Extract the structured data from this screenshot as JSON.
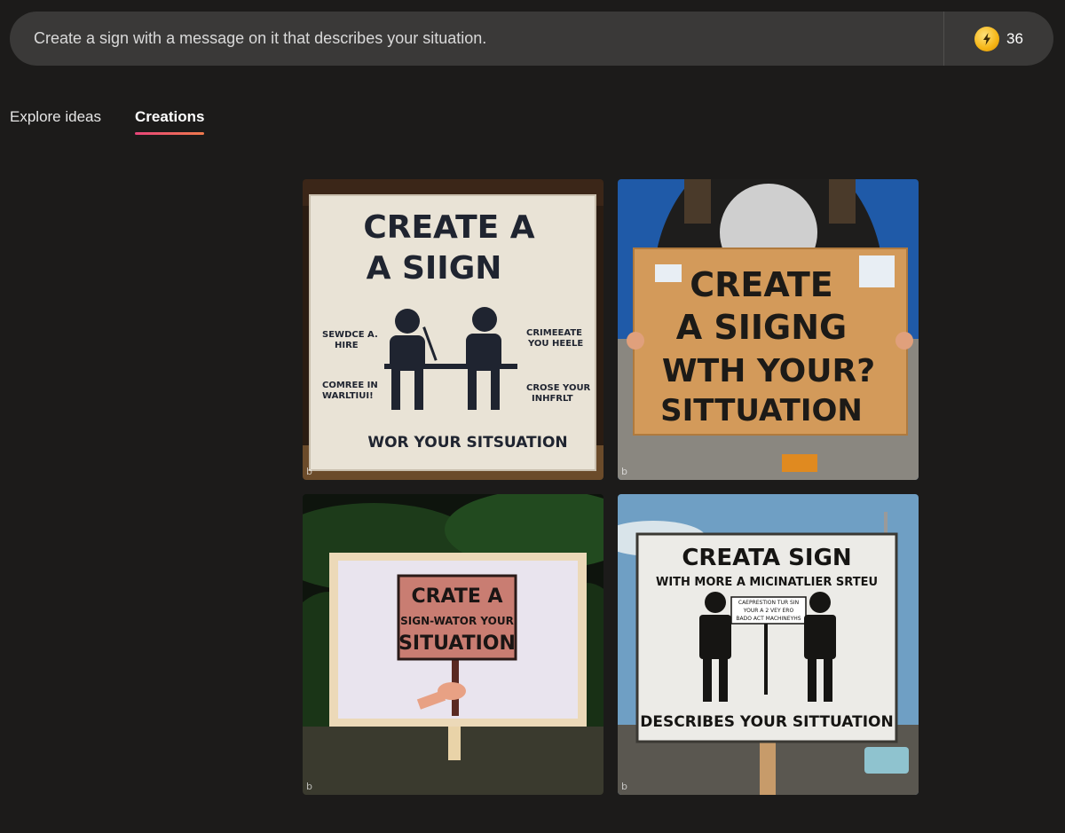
{
  "prompt": {
    "text": "Create a sign with a message on it that describes your situation."
  },
  "boosts": {
    "icon": "lightning-coin-icon",
    "count": "36"
  },
  "tabs": [
    {
      "label": "Explore ideas",
      "active": false
    },
    {
      "label": "Creations",
      "active": true
    }
  ],
  "colors": {
    "accent_start": "#e8457a",
    "accent_end": "#f07a4c"
  },
  "images": [
    {
      "sign_line1": "CREATE A",
      "sign_line2": "A SIIGN",
      "left_note1_a": "SEWDCE A.",
      "left_note1_b": "HIRE",
      "right_note1_a": "CRIMEEATE",
      "right_note1_b": "YOU HEELE",
      "left_note2_a": "COMREE IN",
      "left_note2_b": "WARLTIUI!",
      "right_note2_a": "CROSE YOUR",
      "right_note2_b": "INHFRLT",
      "footer": "WOR YOUR SITSUATION",
      "watermark": "b"
    },
    {
      "line1": "CREATE",
      "line2": "A SIIGNG",
      "line3": "WTH YOUR?",
      "line4": "SITTUATION",
      "watermark": "b"
    },
    {
      "line1": "CRATE A",
      "line2": "SIGN-WATOR YOUR",
      "line3": "SITUATION",
      "watermark": "b"
    },
    {
      "line1": "CREATA SIGN",
      "line2": "WITH MORE A MICINATLIER SRTEU",
      "bubble1": "CAEPRESTION TUR SIN",
      "bubble2": "YOUR A 2 VEY ERO",
      "bubble3": "BADO ACT MACHINEYHS",
      "footer": "DESCRIBES YOUR SITTUATION",
      "watermark": "b"
    }
  ]
}
